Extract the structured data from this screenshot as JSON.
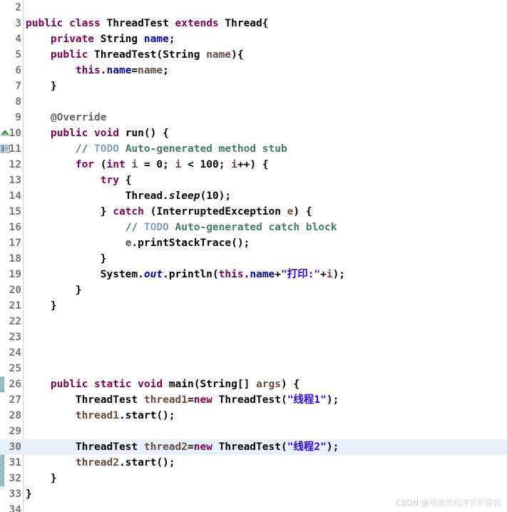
{
  "editor": {
    "language": "Java",
    "theme": "eclipse-light",
    "background_color": "#ffffff",
    "current_line_highlight_color": "#e8f2fe",
    "gutter_text_color": "#777777",
    "colors": {
      "keyword": "#7f0055",
      "field": "#0000c0",
      "local_variable": "#6a4a3c",
      "comment": "#3f7f5f",
      "todo_tag": "#7f9fbf",
      "string": "#2a00ff",
      "annotation": "#646464",
      "plain": "#000000"
    },
    "current_line_number": 30,
    "first_visible_line": 2,
    "last_visible_line": 34
  },
  "gutter_markers": [
    {
      "line": 10,
      "icon": "override-method-marker-icon"
    },
    {
      "line": 11,
      "icon": "todo-task-marker-icon"
    }
  ],
  "lines": [
    {
      "n": 2,
      "highlight": false,
      "tokens": []
    },
    {
      "n": 3,
      "highlight": false,
      "tokens": [
        {
          "t": "public",
          "c": "kw"
        },
        {
          "t": " ",
          "c": "plain"
        },
        {
          "t": "class",
          "c": "kw"
        },
        {
          "t": " ThreadTest ",
          "c": "plain"
        },
        {
          "t": "extends",
          "c": "kw"
        },
        {
          "t": " Thread{",
          "c": "plain"
        }
      ]
    },
    {
      "n": 4,
      "highlight": false,
      "tokens": [
        {
          "t": "    ",
          "c": "plain"
        },
        {
          "t": "private",
          "c": "kw"
        },
        {
          "t": " String ",
          "c": "plain"
        },
        {
          "t": "name",
          "c": "fld"
        },
        {
          "t": ";",
          "c": "plain"
        }
      ]
    },
    {
      "n": 5,
      "highlight": false,
      "tokens": [
        {
          "t": "    ",
          "c": "plain"
        },
        {
          "t": "public",
          "c": "kw"
        },
        {
          "t": " ThreadTest(String ",
          "c": "plain"
        },
        {
          "t": "name",
          "c": "loc"
        },
        {
          "t": "){",
          "c": "plain"
        }
      ]
    },
    {
      "n": 6,
      "highlight": false,
      "tokens": [
        {
          "t": "        ",
          "c": "plain"
        },
        {
          "t": "this",
          "c": "kw"
        },
        {
          "t": ".",
          "c": "plain"
        },
        {
          "t": "name",
          "c": "fld"
        },
        {
          "t": "=",
          "c": "plain"
        },
        {
          "t": "name",
          "c": "loc"
        },
        {
          "t": ";",
          "c": "plain"
        }
      ]
    },
    {
      "n": 7,
      "highlight": false,
      "tokens": [
        {
          "t": "    }",
          "c": "plain"
        }
      ]
    },
    {
      "n": 8,
      "highlight": false,
      "tokens": []
    },
    {
      "n": 9,
      "highlight": false,
      "tokens": [
        {
          "t": "    ",
          "c": "plain"
        },
        {
          "t": "@Override",
          "c": "ann"
        }
      ]
    },
    {
      "n": 10,
      "highlight": false,
      "tokens": [
        {
          "t": "    ",
          "c": "plain"
        },
        {
          "t": "public",
          "c": "kw"
        },
        {
          "t": " ",
          "c": "plain"
        },
        {
          "t": "void",
          "c": "kw"
        },
        {
          "t": " run() {",
          "c": "plain"
        }
      ]
    },
    {
      "n": 11,
      "highlight": false,
      "tokens": [
        {
          "t": "        ",
          "c": "plain"
        },
        {
          "t": "// ",
          "c": "cmt"
        },
        {
          "t": "TODO",
          "c": "todo"
        },
        {
          "t": " Auto-generated method stub",
          "c": "cmt"
        }
      ]
    },
    {
      "n": 12,
      "highlight": false,
      "tokens": [
        {
          "t": "        ",
          "c": "plain"
        },
        {
          "t": "for",
          "c": "kw"
        },
        {
          "t": " (",
          "c": "plain"
        },
        {
          "t": "int",
          "c": "kw"
        },
        {
          "t": " ",
          "c": "plain"
        },
        {
          "t": "i",
          "c": "loc"
        },
        {
          "t": " = ",
          "c": "plain"
        },
        {
          "t": "0",
          "c": "num"
        },
        {
          "t": "; ",
          "c": "plain"
        },
        {
          "t": "i",
          "c": "loc"
        },
        {
          "t": " < ",
          "c": "plain"
        },
        {
          "t": "100",
          "c": "num"
        },
        {
          "t": "; ",
          "c": "plain"
        },
        {
          "t": "i",
          "c": "loc"
        },
        {
          "t": "++) {",
          "c": "plain"
        }
      ]
    },
    {
      "n": 13,
      "highlight": false,
      "tokens": [
        {
          "t": "            ",
          "c": "plain"
        },
        {
          "t": "try",
          "c": "kw"
        },
        {
          "t": " {",
          "c": "plain"
        }
      ]
    },
    {
      "n": 14,
      "highlight": false,
      "tokens": [
        {
          "t": "                Thread.",
          "c": "plain"
        },
        {
          "t": "sleep",
          "c": "statm"
        },
        {
          "t": "(",
          "c": "plain"
        },
        {
          "t": "10",
          "c": "num"
        },
        {
          "t": ");",
          "c": "plain"
        }
      ]
    },
    {
      "n": 15,
      "highlight": false,
      "tokens": [
        {
          "t": "            } ",
          "c": "plain"
        },
        {
          "t": "catch",
          "c": "kw"
        },
        {
          "t": " (InterruptedException ",
          "c": "plain"
        },
        {
          "t": "e",
          "c": "loc"
        },
        {
          "t": ") {",
          "c": "plain"
        }
      ]
    },
    {
      "n": 16,
      "highlight": false,
      "tokens": [
        {
          "t": "                ",
          "c": "plain"
        },
        {
          "t": "// ",
          "c": "cmt"
        },
        {
          "t": "TODO",
          "c": "todo"
        },
        {
          "t": " Auto-generated catch block",
          "c": "cmt"
        }
      ]
    },
    {
      "n": 17,
      "highlight": false,
      "tokens": [
        {
          "t": "                ",
          "c": "plain"
        },
        {
          "t": "e",
          "c": "loc"
        },
        {
          "t": ".printStackTrace();",
          "c": "plain"
        }
      ]
    },
    {
      "n": 18,
      "highlight": false,
      "tokens": [
        {
          "t": "            }",
          "c": "plain"
        }
      ]
    },
    {
      "n": 19,
      "highlight": false,
      "tokens": [
        {
          "t": "            System.",
          "c": "plain"
        },
        {
          "t": "out",
          "c": "stat"
        },
        {
          "t": ".println(",
          "c": "plain"
        },
        {
          "t": "this",
          "c": "kw"
        },
        {
          "t": ".",
          "c": "plain"
        },
        {
          "t": "name",
          "c": "fld"
        },
        {
          "t": "+",
          "c": "plain"
        },
        {
          "t": "\"打印:\"",
          "c": "str-cn"
        },
        {
          "t": "+",
          "c": "plain"
        },
        {
          "t": "i",
          "c": "loc"
        },
        {
          "t": ");",
          "c": "plain"
        }
      ]
    },
    {
      "n": 20,
      "highlight": false,
      "tokens": [
        {
          "t": "        }",
          "c": "plain"
        }
      ]
    },
    {
      "n": 21,
      "highlight": false,
      "tokens": [
        {
          "t": "    }",
          "c": "plain"
        }
      ]
    },
    {
      "n": 22,
      "highlight": false,
      "tokens": []
    },
    {
      "n": 23,
      "highlight": false,
      "tokens": []
    },
    {
      "n": 24,
      "highlight": false,
      "tokens": []
    },
    {
      "n": 25,
      "highlight": false,
      "tokens": []
    },
    {
      "n": 26,
      "highlight": false,
      "tokens": [
        {
          "t": "    ",
          "c": "plain"
        },
        {
          "t": "public",
          "c": "kw"
        },
        {
          "t": " ",
          "c": "plain"
        },
        {
          "t": "static",
          "c": "kw"
        },
        {
          "t": " ",
          "c": "plain"
        },
        {
          "t": "void",
          "c": "kw"
        },
        {
          "t": " main(String[] ",
          "c": "plain"
        },
        {
          "t": "args",
          "c": "loc"
        },
        {
          "t": ") {",
          "c": "plain"
        }
      ]
    },
    {
      "n": 27,
      "highlight": false,
      "tokens": [
        {
          "t": "        ThreadTest ",
          "c": "plain"
        },
        {
          "t": "thread1",
          "c": "loc"
        },
        {
          "t": "=",
          "c": "plain"
        },
        {
          "t": "new",
          "c": "kw"
        },
        {
          "t": " ThreadTest(",
          "c": "plain"
        },
        {
          "t": "\"线程1\"",
          "c": "str-cn"
        },
        {
          "t": ");",
          "c": "plain"
        }
      ]
    },
    {
      "n": 28,
      "highlight": false,
      "tokens": [
        {
          "t": "        ",
          "c": "plain"
        },
        {
          "t": "thread1",
          "c": "loc"
        },
        {
          "t": ".start();",
          "c": "plain"
        }
      ]
    },
    {
      "n": 29,
      "highlight": false,
      "tokens": []
    },
    {
      "n": 30,
      "highlight": true,
      "tokens": [
        {
          "t": "        ThreadTest ",
          "c": "plain"
        },
        {
          "t": "thread2",
          "c": "loc"
        },
        {
          "t": "=",
          "c": "plain"
        },
        {
          "t": "new",
          "c": "kw"
        },
        {
          "t": " ThreadTest(",
          "c": "plain"
        },
        {
          "t": "\"线程2\"",
          "c": "str-cn"
        },
        {
          "t": ");",
          "c": "plain"
        }
      ]
    },
    {
      "n": 31,
      "highlight": false,
      "tokens": [
        {
          "t": "        ",
          "c": "plain"
        },
        {
          "t": "thread2",
          "c": "loc"
        },
        {
          "t": ".start();",
          "c": "plain"
        }
      ]
    },
    {
      "n": 32,
      "highlight": false,
      "tokens": [
        {
          "t": "    }",
          "c": "plain"
        }
      ]
    },
    {
      "n": 33,
      "highlight": false,
      "tokens": [
        {
          "t": "}",
          "c": "plain"
        }
      ]
    },
    {
      "n": 34,
      "highlight": false,
      "tokens": []
    }
  ],
  "watermark": {
    "prefix": "CSDN @",
    "author": "嘟嘟的程序员铲屎官"
  }
}
